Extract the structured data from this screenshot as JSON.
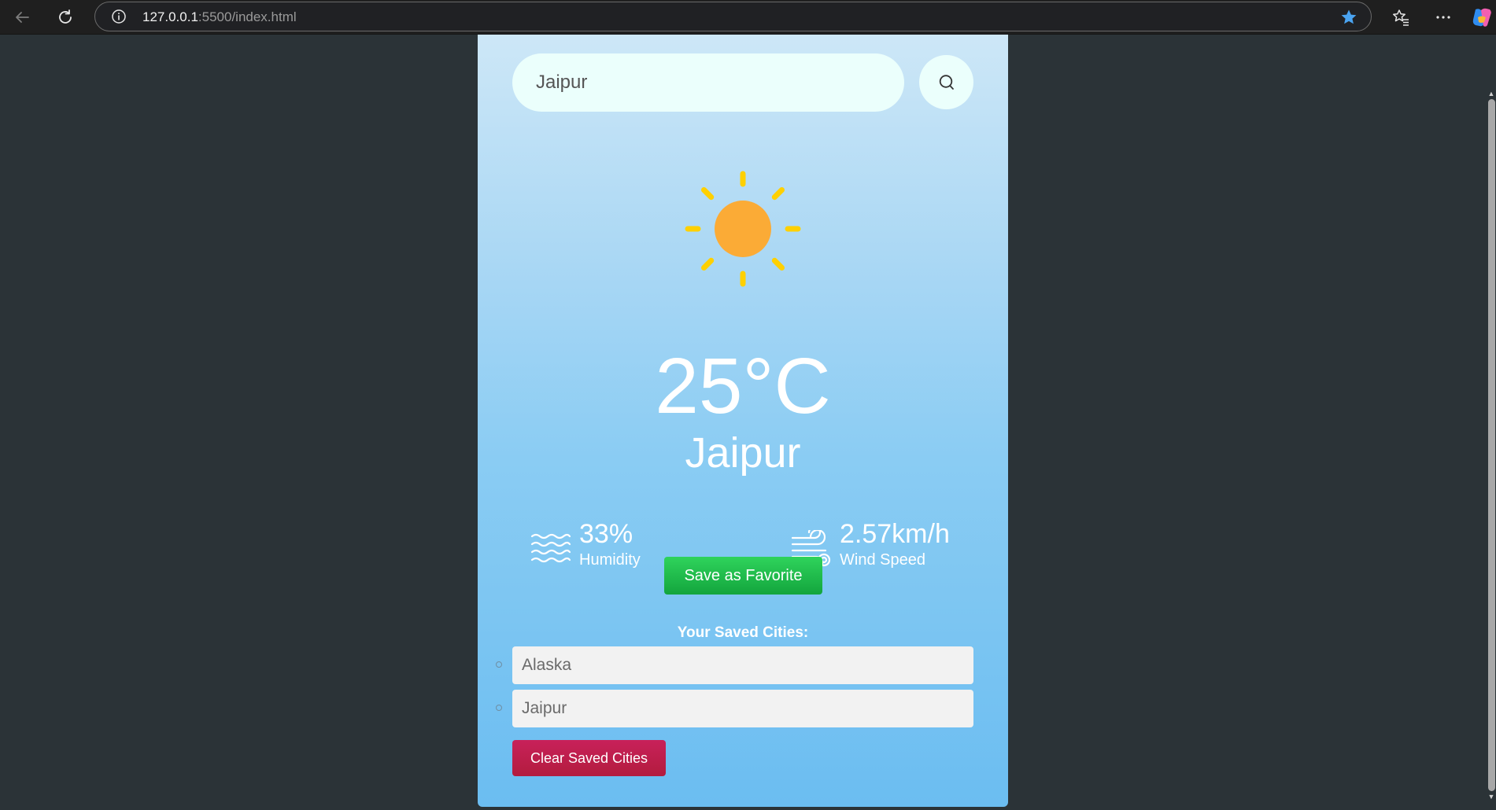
{
  "browser": {
    "url_host": "127.0.0.1",
    "url_rest": ":5500/index.html"
  },
  "search": {
    "value": "Jaipur"
  },
  "weather": {
    "icon": "sun-icon",
    "temperature": "25°C",
    "city": "Jaipur",
    "humidity_value": "33%",
    "humidity_label": "Humidity",
    "wind_value": "2.57km/h",
    "wind_label": "Wind Speed"
  },
  "actions": {
    "save_label": "Save as Favorite",
    "clear_label": "Clear Saved Cities"
  },
  "saved": {
    "title": "Your Saved Cities:",
    "cities": [
      "Alaska",
      "Jaipur"
    ]
  },
  "colors": {
    "page_background": "#2b3337",
    "card_gradient_top": "#cde7f7",
    "card_gradient_bottom": "#6bbdf1",
    "save_button": "#1fb84a",
    "clear_button": "#be1f4c",
    "sun": "#fbab36",
    "sun_rays": "#ffd000"
  }
}
